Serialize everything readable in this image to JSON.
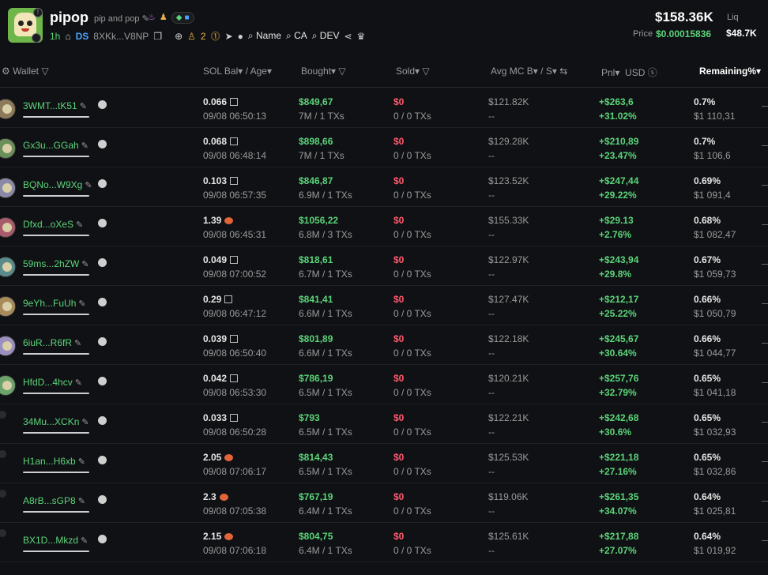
{
  "header": {
    "title": "pipop",
    "subtitle": "pip and pop",
    "age": "1h",
    "ds": "DS",
    "address": "8XKk...V8NP",
    "holders_count": "2",
    "search_name": "Name",
    "search_ca": "CA",
    "search_dev": "DEV",
    "market_cap": "$158.36K",
    "liq_label": "Liq",
    "liq_value": "$48.7K",
    "price_label": "Price",
    "price_value": "$0.00015836"
  },
  "columns": {
    "wallet": "Wallet",
    "sol_bal": "SOL Bal",
    "age": "/ Age",
    "bought": "Bought",
    "sold": "Sold",
    "avg_mc": "Avg MC B",
    "avg_mc_s": "/ S",
    "pnl": "Pnl",
    "usd": "USD",
    "remaining": "Remaining%"
  },
  "rows": [
    {
      "wallet": "3WMT...tK51",
      "sol": "0.066",
      "icon": "box",
      "date": "09/08 06:50:13",
      "bought": "$849,67",
      "bought_sub": "7M / 1 TXs",
      "sold": "$0",
      "sold_sub": "0 / 0 TXs",
      "avg": "$121.82K",
      "avg_sub": "--",
      "pnl": "+$263,6",
      "pnl_pct": "+31.02%",
      "rem": "0.7%",
      "rem_usd": "$1 110,31"
    },
    {
      "wallet": "Gx3u...GGah",
      "sol": "0.068",
      "icon": "box",
      "date": "09/08 06:48:14",
      "bought": "$898,66",
      "bought_sub": "7M / 1 TXs",
      "sold": "$0",
      "sold_sub": "0 / 0 TXs",
      "avg": "$129.28K",
      "avg_sub": "--",
      "pnl": "+$210,89",
      "pnl_pct": "+23.47%",
      "rem": "0.7%",
      "rem_usd": "$1 106,6"
    },
    {
      "wallet": "BQNo...W9Xg",
      "sol": "0.103",
      "icon": "box",
      "date": "09/08 06:57:35",
      "bought": "$846,87",
      "bought_sub": "6.9M / 1 TXs",
      "sold": "$0",
      "sold_sub": "0 / 0 TXs",
      "avg": "$123.52K",
      "avg_sub": "--",
      "pnl": "+$247,44",
      "pnl_pct": "+29.22%",
      "rem": "0.69%",
      "rem_usd": "$1 091,4"
    },
    {
      "wallet": "Dfxd...oXeS",
      "sol": "1.39",
      "icon": "shrimp",
      "date": "09/08 06:45:31",
      "bought": "$1056,22",
      "bought_sub": "6.8M / 3 TXs",
      "sold": "$0",
      "sold_sub": "0 / 0 TXs",
      "avg": "$155.33K",
      "avg_sub": "--",
      "pnl": "+$29.13",
      "pnl_pct": "+2.76%",
      "rem": "0.68%",
      "rem_usd": "$1 082,47"
    },
    {
      "wallet": "59ms...2hZW",
      "sol": "0.049",
      "icon": "box",
      "date": "09/08 07:00:52",
      "bought": "$818,61",
      "bought_sub": "6.7M / 1 TXs",
      "sold": "$0",
      "sold_sub": "0 / 0 TXs",
      "avg": "$122.97K",
      "avg_sub": "--",
      "pnl": "+$243,94",
      "pnl_pct": "+29.8%",
      "rem": "0.67%",
      "rem_usd": "$1 059,73"
    },
    {
      "wallet": "9eYh...FuUh",
      "sol": "0.29",
      "icon": "box",
      "date": "09/08 06:47:12",
      "bought": "$841,41",
      "bought_sub": "6.6M / 1 TXs",
      "sold": "$0",
      "sold_sub": "0 / 0 TXs",
      "avg": "$127.47K",
      "avg_sub": "--",
      "pnl": "+$212,17",
      "pnl_pct": "+25.22%",
      "rem": "0.66%",
      "rem_usd": "$1 050,79"
    },
    {
      "wallet": "6iuR...R6fR",
      "sol": "0.039",
      "icon": "box",
      "date": "09/08 06:50:40",
      "bought": "$801,89",
      "bought_sub": "6.6M / 1 TXs",
      "sold": "$0",
      "sold_sub": "0 / 0 TXs",
      "avg": "$122.18K",
      "avg_sub": "--",
      "pnl": "+$245,67",
      "pnl_pct": "+30.64%",
      "rem": "0.66%",
      "rem_usd": "$1 044,77"
    },
    {
      "wallet": "HfdD...4hcv",
      "sol": "0.042",
      "icon": "box",
      "date": "09/08 06:53:30",
      "bought": "$786,19",
      "bought_sub": "6.5M / 1 TXs",
      "sold": "$0",
      "sold_sub": "0 / 0 TXs",
      "avg": "$120.21K",
      "avg_sub": "--",
      "pnl": "+$257,76",
      "pnl_pct": "+32.79%",
      "rem": "0.65%",
      "rem_usd": "$1 041,18"
    },
    {
      "wallet": "34Mu...XCKn",
      "sol": "0.033",
      "icon": "box",
      "date": "09/08 06:50:28",
      "bought": "$793",
      "bought_sub": "6.5M / 1 TXs",
      "sold": "$0",
      "sold_sub": "0 / 0 TXs",
      "avg": "$122.21K",
      "avg_sub": "--",
      "pnl": "+$242,68",
      "pnl_pct": "+30.6%",
      "rem": "0.65%",
      "rem_usd": "$1 032,93"
    },
    {
      "wallet": "H1an...H6xb",
      "sol": "2.05",
      "icon": "shrimp",
      "date": "09/08 07:06:17",
      "bought": "$814,43",
      "bought_sub": "6.5M / 1 TXs",
      "sold": "$0",
      "sold_sub": "0 / 0 TXs",
      "avg": "$125.53K",
      "avg_sub": "--",
      "pnl": "+$221,18",
      "pnl_pct": "+27.16%",
      "rem": "0.65%",
      "rem_usd": "$1 032,86"
    },
    {
      "wallet": "A8rB...sGP8",
      "sol": "2.3",
      "icon": "shrimp",
      "date": "09/08 07:05:38",
      "bought": "$767,19",
      "bought_sub": "6.4M / 1 TXs",
      "sold": "$0",
      "sold_sub": "0 / 0 TXs",
      "avg": "$119.06K",
      "avg_sub": "--",
      "pnl": "+$261,35",
      "pnl_pct": "+34.07%",
      "rem": "0.64%",
      "rem_usd": "$1 025,81"
    },
    {
      "wallet": "BX1D...Mkzd",
      "sol": "2.15",
      "icon": "shrimp",
      "date": "09/08 07:06:18",
      "bought": "$804,75",
      "bought_sub": "6.4M / 1 TXs",
      "sold": "$0",
      "sold_sub": "0 / 0 TXs",
      "avg": "$125.61K",
      "avg_sub": "--",
      "pnl": "+$217,88",
      "pnl_pct": "+27.07%",
      "rem": "0.64%",
      "rem_usd": "$1 019,92"
    }
  ]
}
